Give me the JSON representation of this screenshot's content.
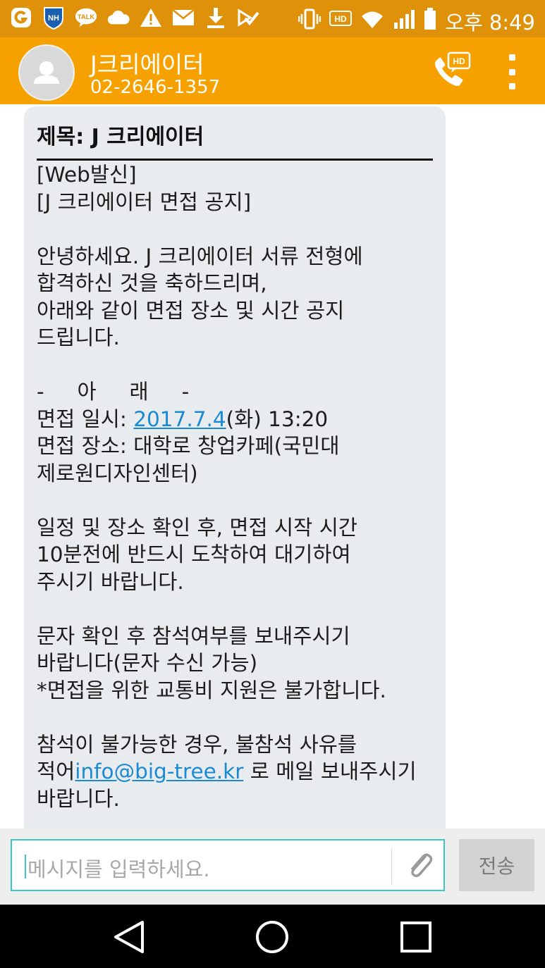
{
  "status_bar": {
    "time": "오후 8:49",
    "icons": [
      "g-icon",
      "nh-bank-icon",
      "kakaotalk-icon",
      "cloud-icon",
      "warning-icon",
      "mail-icon",
      "download-icon",
      "check-icon",
      "vibrate-icon",
      "hd-icon",
      "wifi-icon",
      "signal-icon",
      "battery-icon"
    ],
    "nh_label": "NH",
    "talk_label": "TALK",
    "hd_label": "HD"
  },
  "header": {
    "contact_name": "J크리에이터",
    "contact_number": "02-2646-1357",
    "call_badge": "HD"
  },
  "message": {
    "subject": "제목: J 크리에이터",
    "lines": [
      "[Web발신]",
      "[J 크리에이터 면접 공지]",
      "",
      "안녕하세요. J 크리에이터 서류 전형에",
      "합격하신 것을 축하드리며,",
      "아래와 같이 면접 장소 및 시간 공지",
      "드립니다.",
      "",
      "-     아     래     -"
    ],
    "date_prefix": "면접 일시: ",
    "date_link": "2017.7.4",
    "date_suffix": "(화) 13:20",
    "lines2": [
      "면접 장소: 대학로 창업카페(국민대",
      "제로원디자인센터)",
      "",
      "일정 및 장소 확인 후, 면접 시작 시간",
      "10분전에 반드시 도착하여 대기하여",
      "주시기 바랍니다.",
      "",
      "문자 확인 후 참석여부를 보내주시기",
      "바랍니다(문자 수신 가능)",
      "*면접을 위한 교통비 지원은 불가합니다.",
      "",
      "참석이 불가능한 경우, 불참석 사유를"
    ],
    "email_prefix": "적어",
    "email_link": "info@big-tree.kr",
    "email_suffix": " 로 메일 보내주시기",
    "last_line": "바랍니다."
  },
  "composer": {
    "placeholder": "메시지를 입력하세요.",
    "send_label": "전송"
  },
  "colors": {
    "status_bar": "#e0910a",
    "app_bar": "#f7a100",
    "bubble": "#e9ecef",
    "link": "#1a8ad4",
    "input_border": "#3cc6c4"
  }
}
